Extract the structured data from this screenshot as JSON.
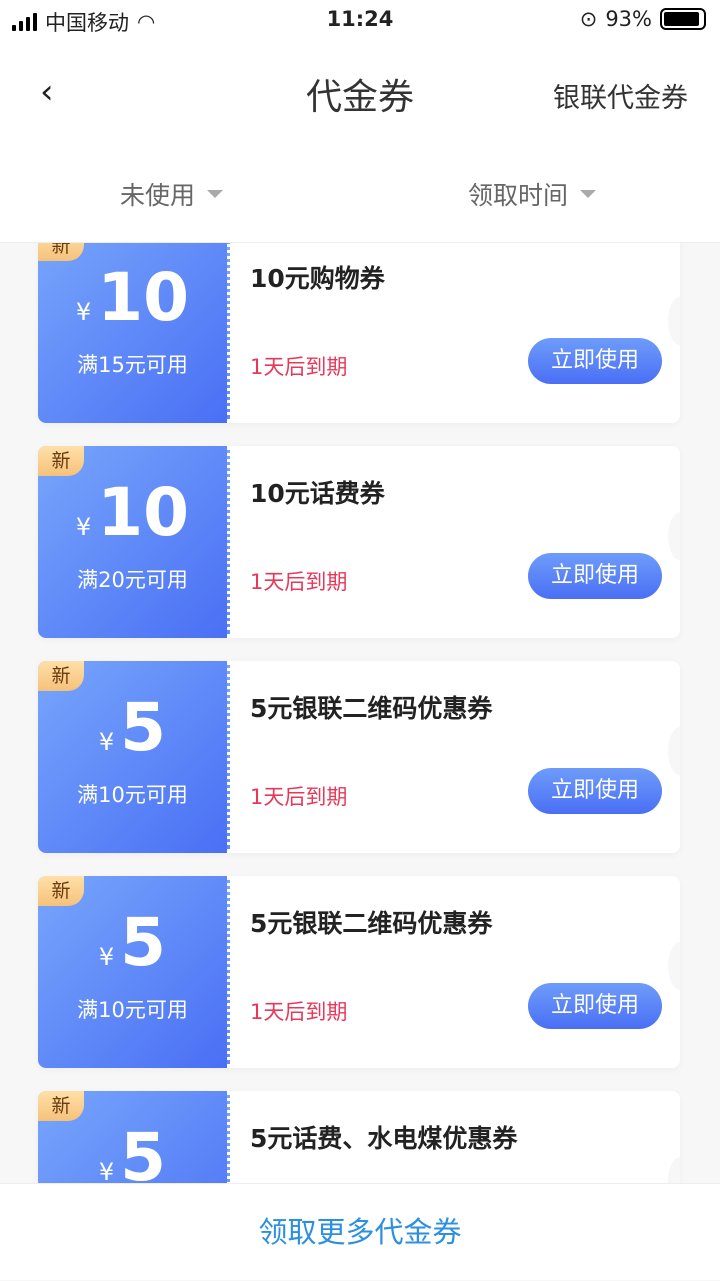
{
  "status_bar": {
    "carrier": "中国移动",
    "time": "11:24",
    "battery": "93%",
    "battery_level": 0.93
  },
  "header": {
    "title": "代金券",
    "right_link": "银联代金券",
    "back_icon": "chevron-left-icon"
  },
  "filters": [
    {
      "label": "未使用"
    },
    {
      "label": "领取时间"
    }
  ],
  "coupons": [
    {
      "badge": "新",
      "currency": "¥",
      "amount": "10",
      "condition": "满15元可用",
      "name": "10元购物券",
      "expiry": "1天后到期",
      "action": "立即使用"
    },
    {
      "badge": "新",
      "currency": "¥",
      "amount": "10",
      "condition": "满20元可用",
      "name": "10元话费券",
      "expiry": "1天后到期",
      "action": "立即使用"
    },
    {
      "badge": "新",
      "currency": "¥",
      "amount": "5",
      "condition": "满10元可用",
      "name": "5元银联二维码优惠券",
      "expiry": "1天后到期",
      "action": "立即使用"
    },
    {
      "badge": "新",
      "currency": "¥",
      "amount": "5",
      "condition": "满10元可用",
      "name": "5元银联二维码优惠券",
      "expiry": "1天后到期",
      "action": "立即使用"
    },
    {
      "badge": "新",
      "currency": "¥",
      "amount": "5",
      "condition": "",
      "name": "5元话费、水电煤优惠券",
      "expiry": "",
      "action": ""
    }
  ],
  "footer": {
    "link": "领取更多代金券"
  },
  "colors": {
    "accent": "#4a6ff5",
    "expiry": "#e8385a",
    "link": "#2d8fe0"
  }
}
